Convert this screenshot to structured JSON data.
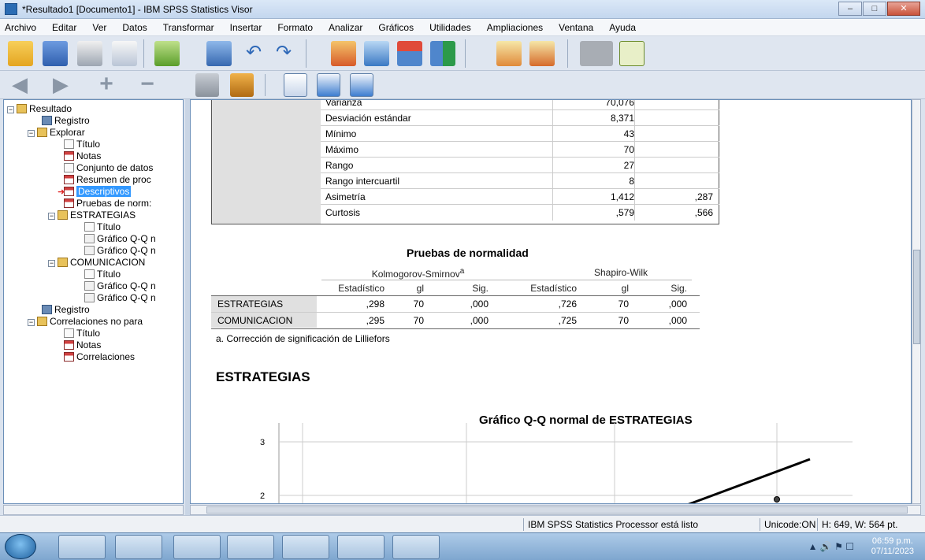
{
  "window": {
    "title": "*Resultado1 [Documento1] - IBM SPSS Statistics Visor",
    "buttons": {
      "minimize": "–",
      "maximize": "□",
      "close": "✕"
    }
  },
  "menu": [
    "Archivo",
    "Editar",
    "Ver",
    "Datos",
    "Transformar",
    "Insertar",
    "Formato",
    "Analizar",
    "Gráficos",
    "Utilidades",
    "Ampliaciones",
    "Ventana",
    "Ayuda"
  ],
  "toolbar1_icons": [
    "open-folder-icon",
    "save-icon",
    "print-icon",
    "print-preview-icon",
    "export-icon",
    "recall-dialog-icon",
    "undo-icon",
    "redo-icon",
    "go-to-data-icon",
    "go-to-variable-icon",
    "insert-cases-icon",
    "split-file-icon",
    "weight-cases-icon",
    "select-cases-icon",
    "output-disabled-icon",
    "add-icon"
  ],
  "toolbar2_icons": [
    "back-icon",
    "forward-icon",
    "expand-icon",
    "collapse-icon",
    "show-icon",
    "hide-icon",
    "insert-heading-icon",
    "insert-title-icon",
    "insert-text-icon"
  ],
  "tree": {
    "nodes": [
      {
        "label": "Resultado",
        "icon": "book",
        "depth": 0,
        "expand": "−"
      },
      {
        "label": "Registro",
        "icon": "log",
        "depth": 1
      },
      {
        "label": "Explorar",
        "icon": "book",
        "depth": 1,
        "expand": "−"
      },
      {
        "label": "Título",
        "icon": "title",
        "depth": 2
      },
      {
        "label": "Notas",
        "icon": "tbl",
        "depth": 2
      },
      {
        "label": "Conjunto de datos",
        "icon": "title",
        "depth": 2
      },
      {
        "label": "Resumen de proc",
        "icon": "tbl",
        "depth": 2
      },
      {
        "label": "Descriptivos",
        "icon": "tbl",
        "depth": 2,
        "selected": true
      },
      {
        "label": "Pruebas de norm:",
        "icon": "tbl",
        "depth": 2
      },
      {
        "label": "ESTRATEGIAS",
        "icon": "book",
        "depth": 2,
        "expand": "−"
      },
      {
        "label": "Título",
        "icon": "title",
        "depth": 3
      },
      {
        "label": "Gráfico Q-Q n",
        "icon": "chart",
        "depth": 3
      },
      {
        "label": "Gráfico Q-Q n",
        "icon": "chart",
        "depth": 3
      },
      {
        "label": "COMUNICACION",
        "icon": "book",
        "depth": 2,
        "expand": "−"
      },
      {
        "label": "Título",
        "icon": "title",
        "depth": 3
      },
      {
        "label": "Gráfico Q-Q n",
        "icon": "chart",
        "depth": 3
      },
      {
        "label": "Gráfico Q-Q n",
        "icon": "chart",
        "depth": 3
      },
      {
        "label": "Registro",
        "icon": "log",
        "depth": 1
      },
      {
        "label": "Correlaciones no para",
        "icon": "book",
        "depth": 1,
        "expand": "−"
      },
      {
        "label": "Título",
        "icon": "title",
        "depth": 2
      },
      {
        "label": "Notas",
        "icon": "tbl",
        "depth": 2
      },
      {
        "label": "Correlaciones",
        "icon": "tbl",
        "depth": 2
      }
    ]
  },
  "descriptives": {
    "rows": [
      {
        "name": "Varianza",
        "value": "70,076",
        "error": ""
      },
      {
        "name": "Desviación estándar",
        "value": "8,371",
        "error": ""
      },
      {
        "name": "Mínimo",
        "value": "43",
        "error": ""
      },
      {
        "name": "Máximo",
        "value": "70",
        "error": ""
      },
      {
        "name": "Rango",
        "value": "27",
        "error": ""
      },
      {
        "name": "Rango intercuartil",
        "value": "8",
        "error": ""
      },
      {
        "name": "Asimetría",
        "value": "1,412",
        "error": ",287"
      },
      {
        "name": "Curtosis",
        "value": ",579",
        "error": ",566"
      }
    ]
  },
  "normality": {
    "title": "Pruebas de normalidad",
    "group1": "Kolmogorov-Smirnov",
    "group1_sup": "a",
    "group2": "Shapiro-Wilk",
    "columns": [
      "Estadístico",
      "gl",
      "Sig.",
      "Estadístico",
      "gl",
      "Sig."
    ],
    "rows": [
      {
        "label": "ESTRATEGIAS",
        "values": [
          ",298",
          "70",
          ",000",
          ",726",
          "70",
          ",000"
        ]
      },
      {
        "label": "COMUNICACION",
        "values": [
          ",295",
          "70",
          ",000",
          ",725",
          "70",
          ",000"
        ]
      }
    ],
    "footnote": "a. Corrección de significación de Lilliefors"
  },
  "section_heading": "ESTRATEGIAS",
  "chart_data": {
    "type": "scatter",
    "title": "Gráfico Q-Q normal de ESTRATEGIAS",
    "y_ticks": [
      "3",
      "2"
    ],
    "x": [],
    "y": []
  },
  "status": {
    "processor": "IBM SPSS Statistics Processor está listo",
    "unicode": "Unicode:ON",
    "size": "H: 649, W: 564 pt."
  },
  "taskbar": {
    "apps": [
      "internet-explorer-icon",
      "file-explorer-icon",
      "chrome-icon",
      "word-icon",
      "excel-icon",
      "equation-icon",
      "zoom-icon"
    ],
    "time": "06:59 p.m.",
    "date": "07/11/2023"
  }
}
